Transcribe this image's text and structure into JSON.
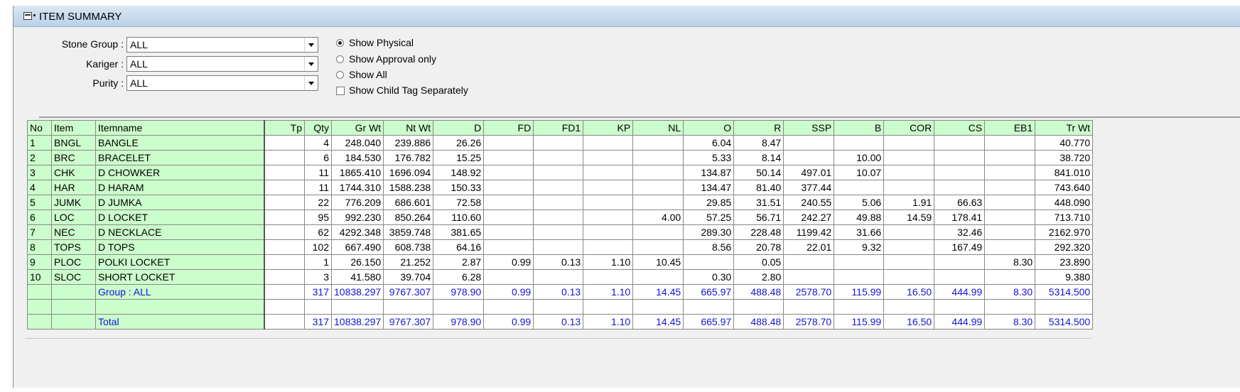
{
  "window": {
    "title": "ITEM SUMMARY"
  },
  "filters": {
    "stone_group_label": "Stone Group :",
    "stone_group_value": "ALL",
    "kariger_label": "Kariger :",
    "kariger_value": "ALL",
    "purity_label": "Purity :",
    "purity_value": "ALL"
  },
  "options": {
    "show_physical": "Show Physical",
    "show_approval_only": "Show Approval only",
    "show_all": "Show All",
    "show_child_tag": "Show Child Tag Separately",
    "selected": "show_physical",
    "child_tag_checked": false
  },
  "grid": {
    "columns": [
      "No",
      "Item",
      "Itemname",
      "Tp",
      "Qty",
      "Gr Wt",
      "Nt Wt",
      "D",
      "FD",
      "FD1",
      "KP",
      "NL",
      "O",
      "R",
      "SSP",
      "B",
      "COR",
      "CS",
      "EB1",
      "Tr Wt"
    ],
    "rows": [
      [
        "1",
        "BNGL",
        "BANGLE",
        "",
        "4",
        "248.040",
        "239.886",
        "26.26",
        "",
        "",
        "",
        "",
        "6.04",
        "8.47",
        "",
        "",
        "",
        "",
        "",
        "40.770"
      ],
      [
        "2",
        "BRC",
        "BRACELET",
        "",
        "6",
        "184.530",
        "176.782",
        "15.25",
        "",
        "",
        "",
        "",
        "5.33",
        "8.14",
        "",
        "10.00",
        "",
        "",
        "",
        "38.720"
      ],
      [
        "3",
        "CHK",
        "D CHOWKER",
        "",
        "11",
        "1865.410",
        "1696.094",
        "148.92",
        "",
        "",
        "",
        "",
        "134.87",
        "50.14",
        "497.01",
        "10.07",
        "",
        "",
        "",
        "841.010"
      ],
      [
        "4",
        "HAR",
        "D HARAM",
        "",
        "11",
        "1744.310",
        "1588.238",
        "150.33",
        "",
        "",
        "",
        "",
        "134.47",
        "81.40",
        "377.44",
        "",
        "",
        "",
        "",
        "743.640"
      ],
      [
        "5",
        "JUMK",
        "D JUMKA",
        "",
        "22",
        "776.209",
        "686.601",
        "72.58",
        "",
        "",
        "",
        "",
        "29.85",
        "31.51",
        "240.55",
        "5.06",
        "1.91",
        "66.63",
        "",
        "448.090"
      ],
      [
        "6",
        "LOC",
        "D LOCKET",
        "",
        "95",
        "992.230",
        "850.264",
        "110.60",
        "",
        "",
        "",
        "4.00",
        "57.25",
        "56.71",
        "242.27",
        "49.88",
        "14.59",
        "178.41",
        "",
        "713.710"
      ],
      [
        "7",
        "NEC",
        "D NECKLACE",
        "",
        "62",
        "4292.348",
        "3859.748",
        "381.65",
        "",
        "",
        "",
        "",
        "289.30",
        "228.48",
        "1199.42",
        "31.66",
        "",
        "32.46",
        "",
        "2162.970"
      ],
      [
        "8",
        "TOPS",
        "D TOPS",
        "",
        "102",
        "667.490",
        "608.738",
        "64.16",
        "",
        "",
        "",
        "",
        "8.56",
        "20.78",
        "22.01",
        "9.32",
        "",
        "167.49",
        "",
        "292.320"
      ],
      [
        "9",
        "PLOC",
        "POLKI LOCKET",
        "",
        "1",
        "26.150",
        "21.252",
        "2.87",
        "0.99",
        "0.13",
        "1.10",
        "10.45",
        "",
        "0.05",
        "",
        "",
        "",
        "",
        "8.30",
        "23.890"
      ],
      [
        "10",
        "SLOC",
        "SHORT LOCKET",
        "",
        "3",
        "41.580",
        "39.704",
        "6.28",
        "",
        "",
        "",
        "",
        "0.30",
        "2.80",
        "",
        "",
        "",
        "",
        "",
        "9.380"
      ]
    ],
    "group_row": [
      "",
      "",
      "Group : ALL",
      "",
      "317",
      "10838.297",
      "9767.307",
      "978.90",
      "0.99",
      "0.13",
      "1.10",
      "14.45",
      "665.97",
      "488.48",
      "2578.70",
      "115.99",
      "16.50",
      "444.99",
      "8.30",
      "5314.500"
    ],
    "blank_row": [
      "",
      "",
      "",
      "",
      "",
      "",
      "",
      "",
      "",
      "",
      "",
      "",
      "",
      "",
      "",
      "",
      "",
      "",
      "",
      ""
    ],
    "total_row": [
      "",
      "",
      "Total",
      "",
      "317",
      "10838.297",
      "9767.307",
      "978.90",
      "0.99",
      "0.13",
      "1.10",
      "14.45",
      "665.97",
      "488.48",
      "2578.70",
      "115.99",
      "16.50",
      "444.99",
      "8.30",
      "5314.500"
    ]
  },
  "colors": {
    "header_bg": "#ccfdcc",
    "total_text": "#1414d6",
    "titlebar": "#c8daee"
  }
}
